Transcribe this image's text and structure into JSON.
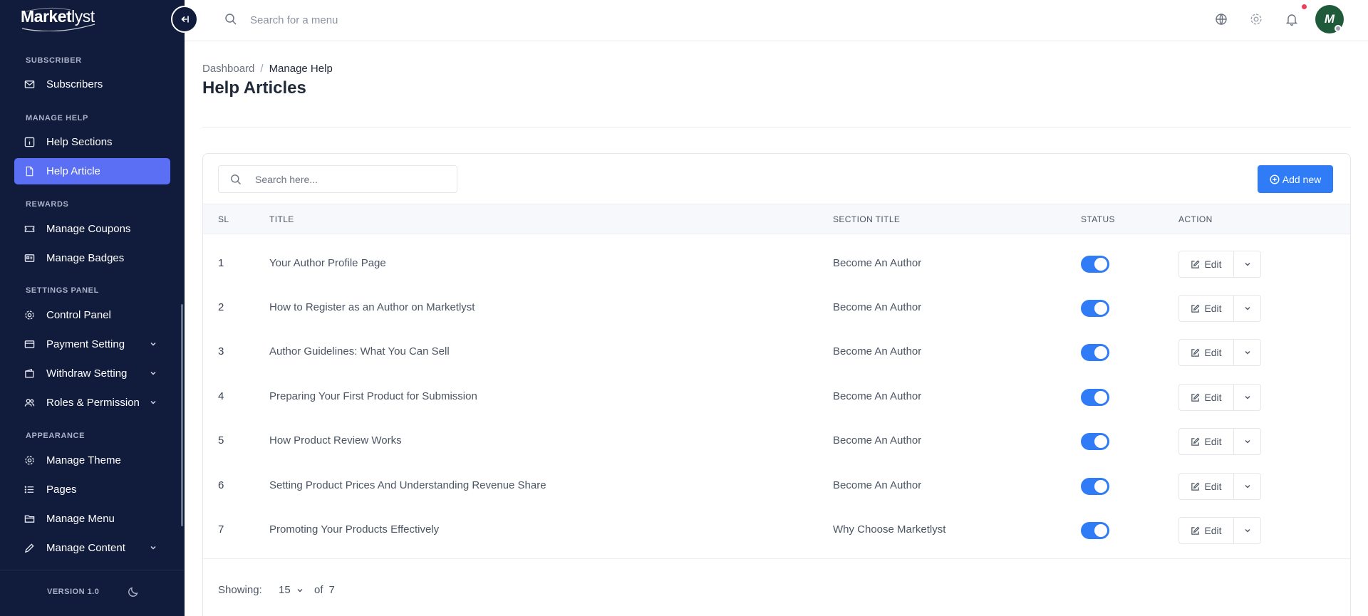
{
  "brand": {
    "name_bold": "Market",
    "name_light": "lyst"
  },
  "sidebar": {
    "sections": [
      {
        "label": "SUBSCRIBER"
      },
      {
        "label": "MANAGE HELP"
      },
      {
        "label": "REWARDS"
      },
      {
        "label": "SETTINGS PANEL"
      },
      {
        "label": "APPEARANCE"
      }
    ],
    "items": [
      {
        "label": "Subscribers",
        "icon": "mail-icon"
      },
      {
        "label": "Help Sections",
        "icon": "info-icon"
      },
      {
        "label": "Help Article",
        "icon": "document-icon",
        "active": true
      },
      {
        "label": "Manage Coupons",
        "icon": "ticket-icon"
      },
      {
        "label": "Manage Badges",
        "icon": "badge-icon"
      },
      {
        "label": "Control Panel",
        "icon": "gear-icon"
      },
      {
        "label": "Payment Setting",
        "icon": "payment-icon",
        "expandable": true
      },
      {
        "label": "Withdraw Setting",
        "icon": "wallet-icon",
        "expandable": true
      },
      {
        "label": "Roles & Permission",
        "icon": "users-icon",
        "expandable": true
      },
      {
        "label": "Manage Theme",
        "icon": "gear-icon"
      },
      {
        "label": "Pages",
        "icon": "list-icon"
      },
      {
        "label": "Manage Menu",
        "icon": "folder-icon"
      },
      {
        "label": "Manage Content",
        "icon": "pencil-icon",
        "expandable": true
      }
    ],
    "version": "VERSION 1.0"
  },
  "topbar": {
    "search_placeholder": "Search for a menu",
    "avatar_initial": "M"
  },
  "breadcrumb": {
    "home": "Dashboard",
    "separator": "/",
    "current": "Manage Help"
  },
  "page_title": "Help Articles",
  "table": {
    "search_placeholder": "Search here...",
    "add_button": "Add new",
    "columns": {
      "sl": "SL",
      "title": "TITLE",
      "section": "SECTION TITLE",
      "status": "STATUS",
      "action": "ACTION"
    },
    "edit_label": "Edit",
    "rows": [
      {
        "sl": "1",
        "title": "Your Author Profile Page",
        "section": "Become An Author",
        "status": true
      },
      {
        "sl": "2",
        "title": "How to Register as an Author on Marketlyst",
        "section": "Become An Author",
        "status": true
      },
      {
        "sl": "3",
        "title": "Author Guidelines: What You Can Sell",
        "section": "Become An Author",
        "status": true
      },
      {
        "sl": "4",
        "title": "Preparing Your First Product for Submission",
        "section": "Become An Author",
        "status": true
      },
      {
        "sl": "5",
        "title": "How Product Review Works",
        "section": "Become An Author",
        "status": true
      },
      {
        "sl": "6",
        "title": "Setting Product Prices And Understanding Revenue Share",
        "section": "Become An Author",
        "status": true
      },
      {
        "sl": "7",
        "title": "Promoting Your Products Effectively",
        "section": "Why Choose Marketlyst",
        "status": true
      }
    ],
    "footer": {
      "showing_label": "Showing:",
      "per_page": "15",
      "of_label": "of",
      "total": "7"
    }
  },
  "colors": {
    "sidebar_bg": "#111c3d",
    "accent": "#5b6ff5",
    "primary": "#2f7cf6",
    "notification": "#ef3e5c"
  }
}
